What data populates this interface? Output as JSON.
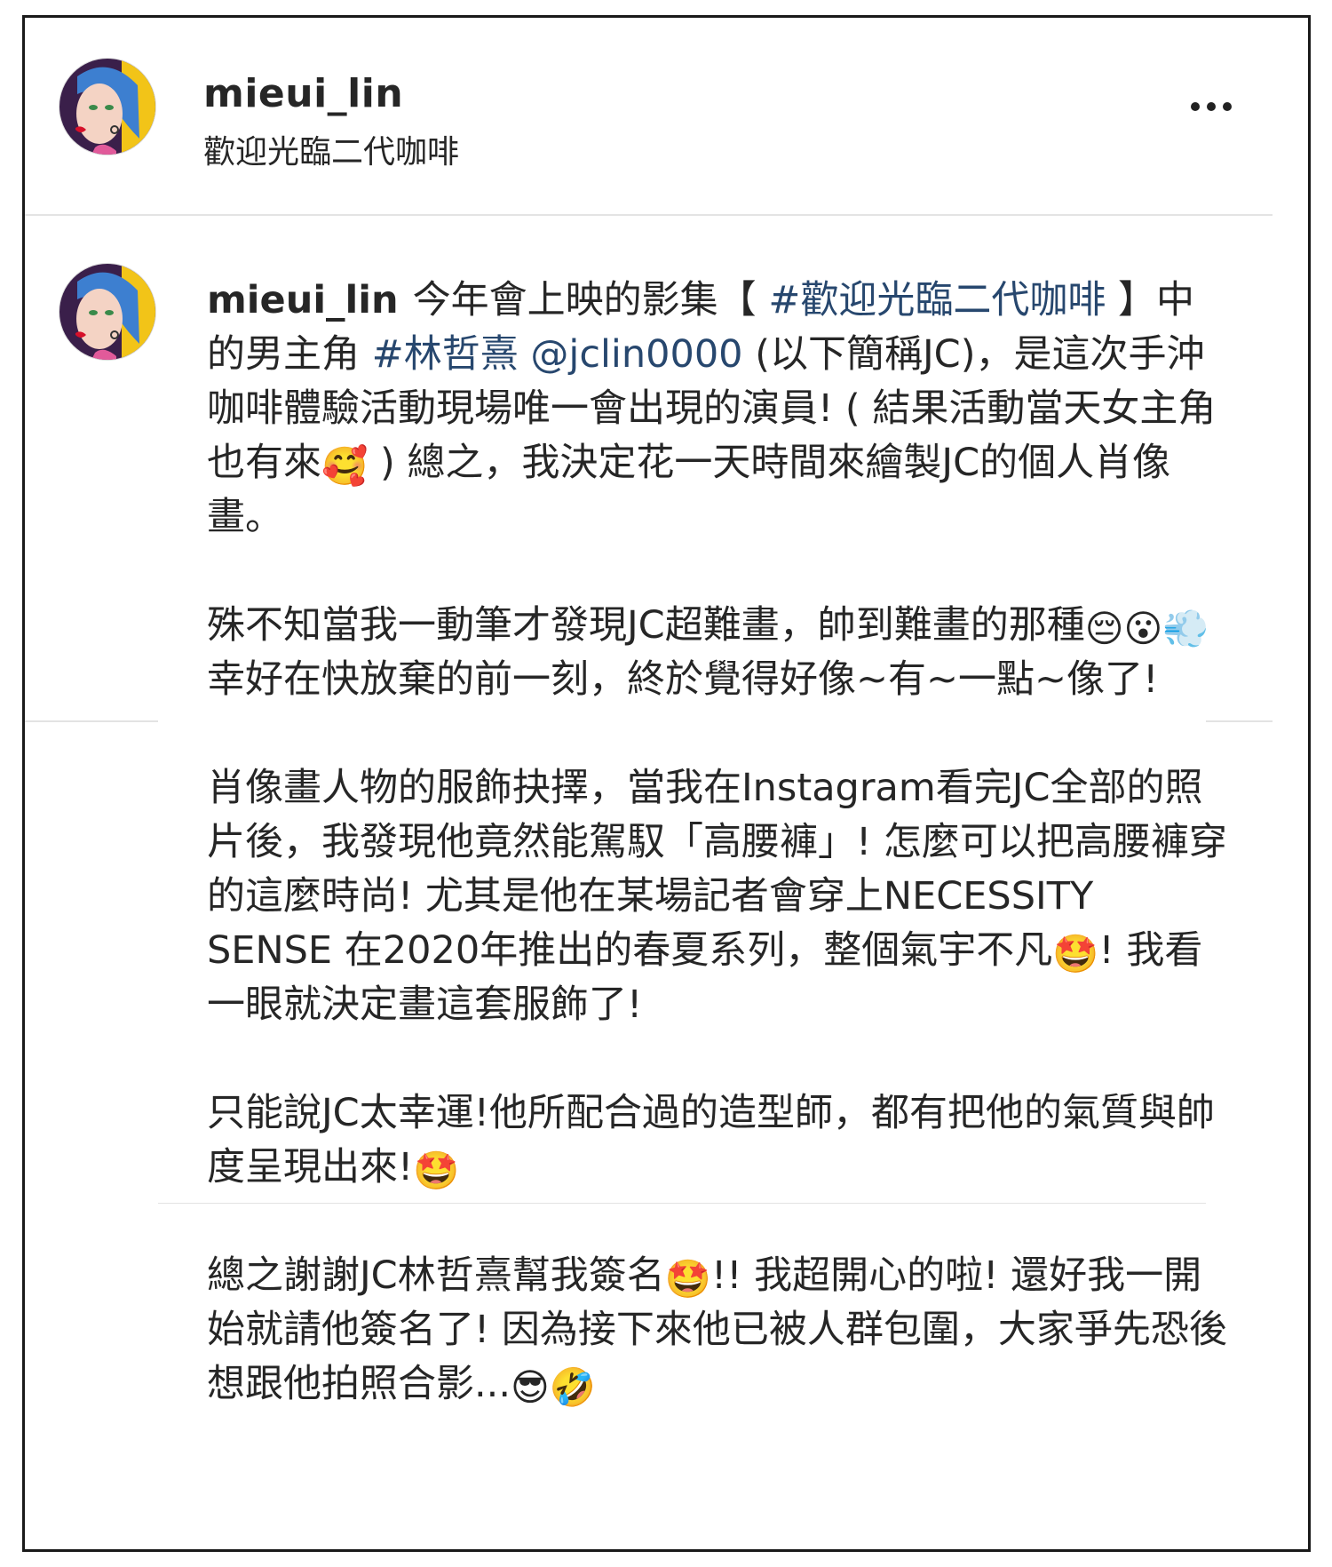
{
  "header": {
    "username": "mieui_lin",
    "subtitle": "歡迎光臨二代咖啡",
    "more_icon": "more-horizontal-icon"
  },
  "caption": {
    "username": "mieui_lin",
    "p1": {
      "t1": "今年會上映的影集【 ",
      "hashtag1": "#歡迎光臨二代咖啡",
      "t2": " 】中的男主角 ",
      "hashtag2": "#林哲熹",
      "t3": " ",
      "mention": "@jclin0000",
      "t4": " (以下簡稱JC)，是這次手沖咖啡體驗活動現場唯一會出現的演員! ( 結果活動當天女主角也有來",
      "e1": "🥰",
      "t5": " ) 總之，我決定花一天時間來繪製JC的個人肖像畫。"
    },
    "p2": {
      "t1": "殊不知當我一動筆才發現JC超難畫，帥到難畫的那種",
      "e1": "😔",
      "e2": "😮",
      "e3": "💨",
      "t2": " 幸好在快放棄的前一刻，終於覺得好像~有~一點~像了!"
    },
    "p3": {
      "t1": "肖像畫人物的服飾抉擇，當我在Instagram看完JC全部的照片後，我發現他竟然能駕馭「高腰褲」! 怎麼可以把高腰褲穿的這麼時尚! 尤其是他在某場記者會穿上NECESSITY SENSE 在2020年推出的春夏系列，整個氣宇不凡",
      "e1": "🤩",
      "t2": "! 我看一眼就決定畫這套服飾了!"
    },
    "p4": {
      "t1": "只能說JC太幸運!他所配合過的造型師，都有把他的氣質與帥度呈現出來!",
      "e1": "🤩"
    },
    "p5": {
      "t1": "總之謝謝JC林哲熹幫我簽名",
      "e1": "🤩",
      "t2": "!! 我超開心的啦! 還好我一開始就請他簽名了! 因為接下來他已被人群包圍，大家爭先恐後想跟他拍照合影...",
      "e2": "😎",
      "e3": "🤣"
    }
  },
  "colors": {
    "text": "#262626",
    "hashtag": "#27476e",
    "divider": "#e3e3e3",
    "frame": "#1a1a1a"
  }
}
